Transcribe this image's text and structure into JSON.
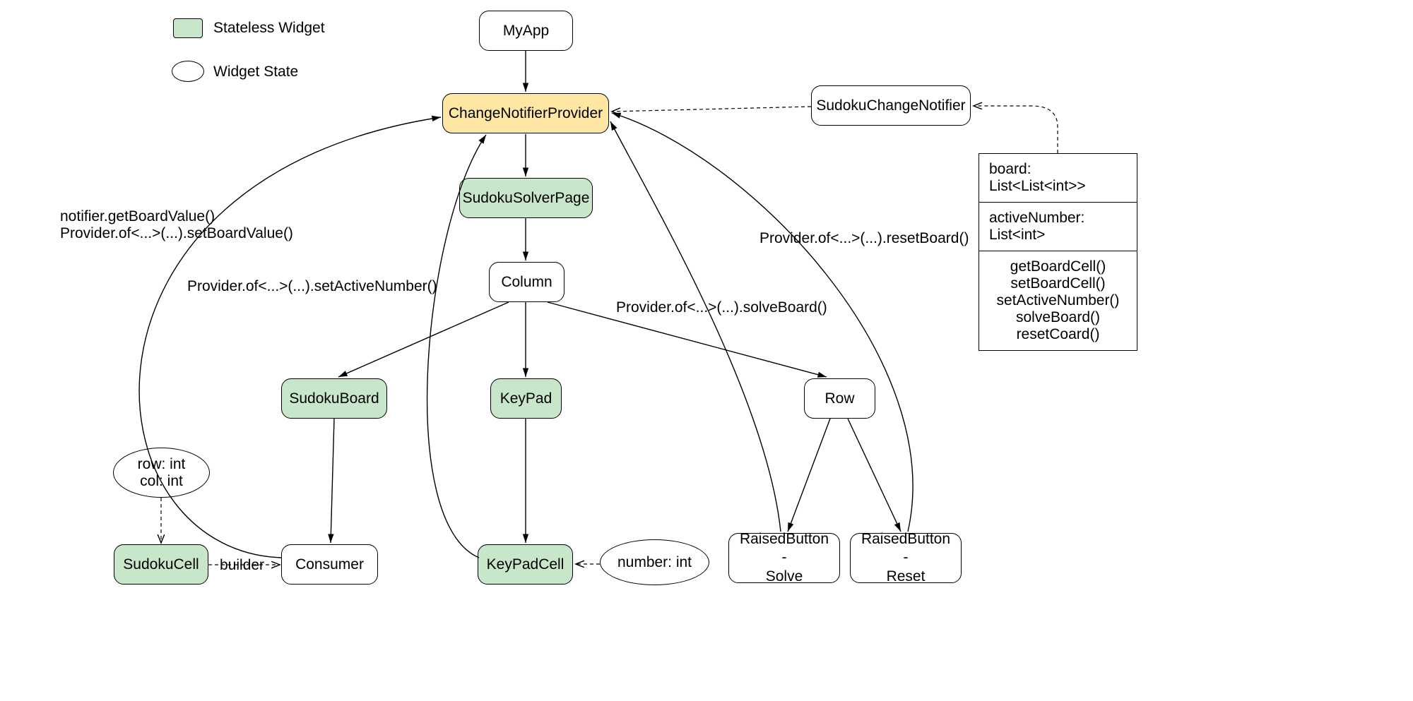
{
  "legend": {
    "stateless": "Stateless Widget",
    "state": "Widget State"
  },
  "nodes": {
    "myapp": "MyApp",
    "cnp": "ChangeNotifierProvider",
    "scn": "SudokuChangeNotifier",
    "ssp": "SudokuSolverPage",
    "column": "Column",
    "sudokuboard": "SudokuBoard",
    "keypad": "KeyPad",
    "row": "Row",
    "consumer": "Consumer",
    "sudokucell": "SudokuCell",
    "keypadcell": "KeyPadCell",
    "rbsolve": "RaisedButton -\nSolve",
    "rbreset": "RaisedButton -\nReset",
    "stateRowCol": "row: int\ncol: int",
    "stateNumber": "number: int"
  },
  "classbox": {
    "board": "board: List<List<int>>",
    "active": "activeNumber: List<int>",
    "methods": "getBoardCell()\nsetBoardCell()\nsetActiveNumber()\nsolveBoard()\nresetCoard()"
  },
  "edgeLabels": {
    "getset": "notifier.getBoardValue()\nProvider.of<...>(...).setBoardValue()",
    "setActive": "Provider.of<...>(...).setActiveNumber()",
    "reset": "Provider.of<...>(...).resetBoard()",
    "solve": "Provider.of<...>(...).solveBoard()",
    "builder": "builder"
  }
}
